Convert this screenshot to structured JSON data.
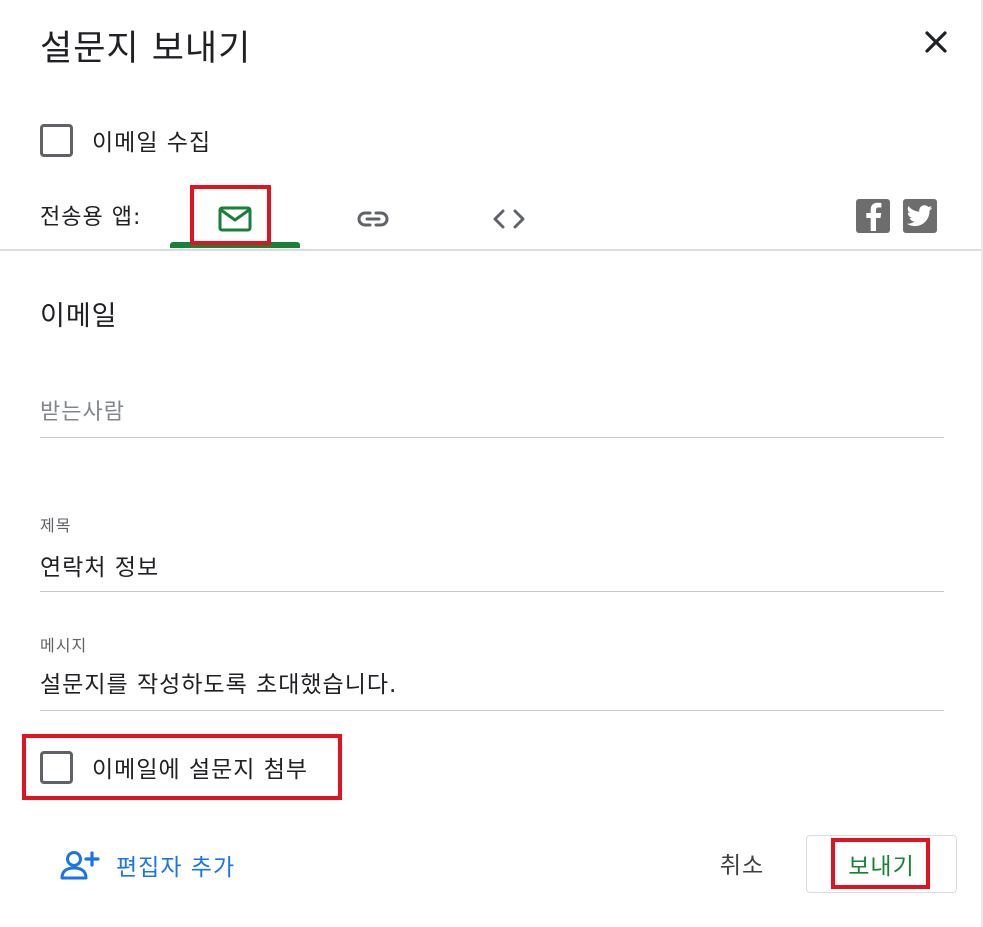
{
  "dialog": {
    "title": "설문지 보내기",
    "close_icon": "close-icon"
  },
  "collect_emails": {
    "label": "이메일 수집",
    "checked": false
  },
  "send_via": {
    "label": "전송용 앱:",
    "tabs": [
      {
        "name": "email",
        "icon": "mail-icon",
        "selected": true
      },
      {
        "name": "link",
        "icon": "link-icon",
        "selected": false
      },
      {
        "name": "embed",
        "icon": "code-icon",
        "selected": false
      }
    ],
    "social": [
      {
        "name": "facebook",
        "icon": "facebook-icon"
      },
      {
        "name": "twitter",
        "icon": "twitter-icon"
      }
    ]
  },
  "email_section": {
    "title": "이메일",
    "recipients": {
      "placeholder": "받는사람",
      "value": ""
    },
    "subject": {
      "label": "제목",
      "value": "연락처 정보"
    },
    "message": {
      "label": "메시지",
      "value": "설문지를 작성하도록 초대했습니다."
    },
    "include_form": {
      "label": "이메일에 설문지 첨부",
      "checked": false
    }
  },
  "footer": {
    "add_editors_label": "편집자 추가",
    "cancel_label": "취소",
    "send_label": "보내기"
  },
  "colors": {
    "accent_green": "#188038",
    "link_blue": "#1a73e8",
    "highlight_red": "#e0141e"
  }
}
